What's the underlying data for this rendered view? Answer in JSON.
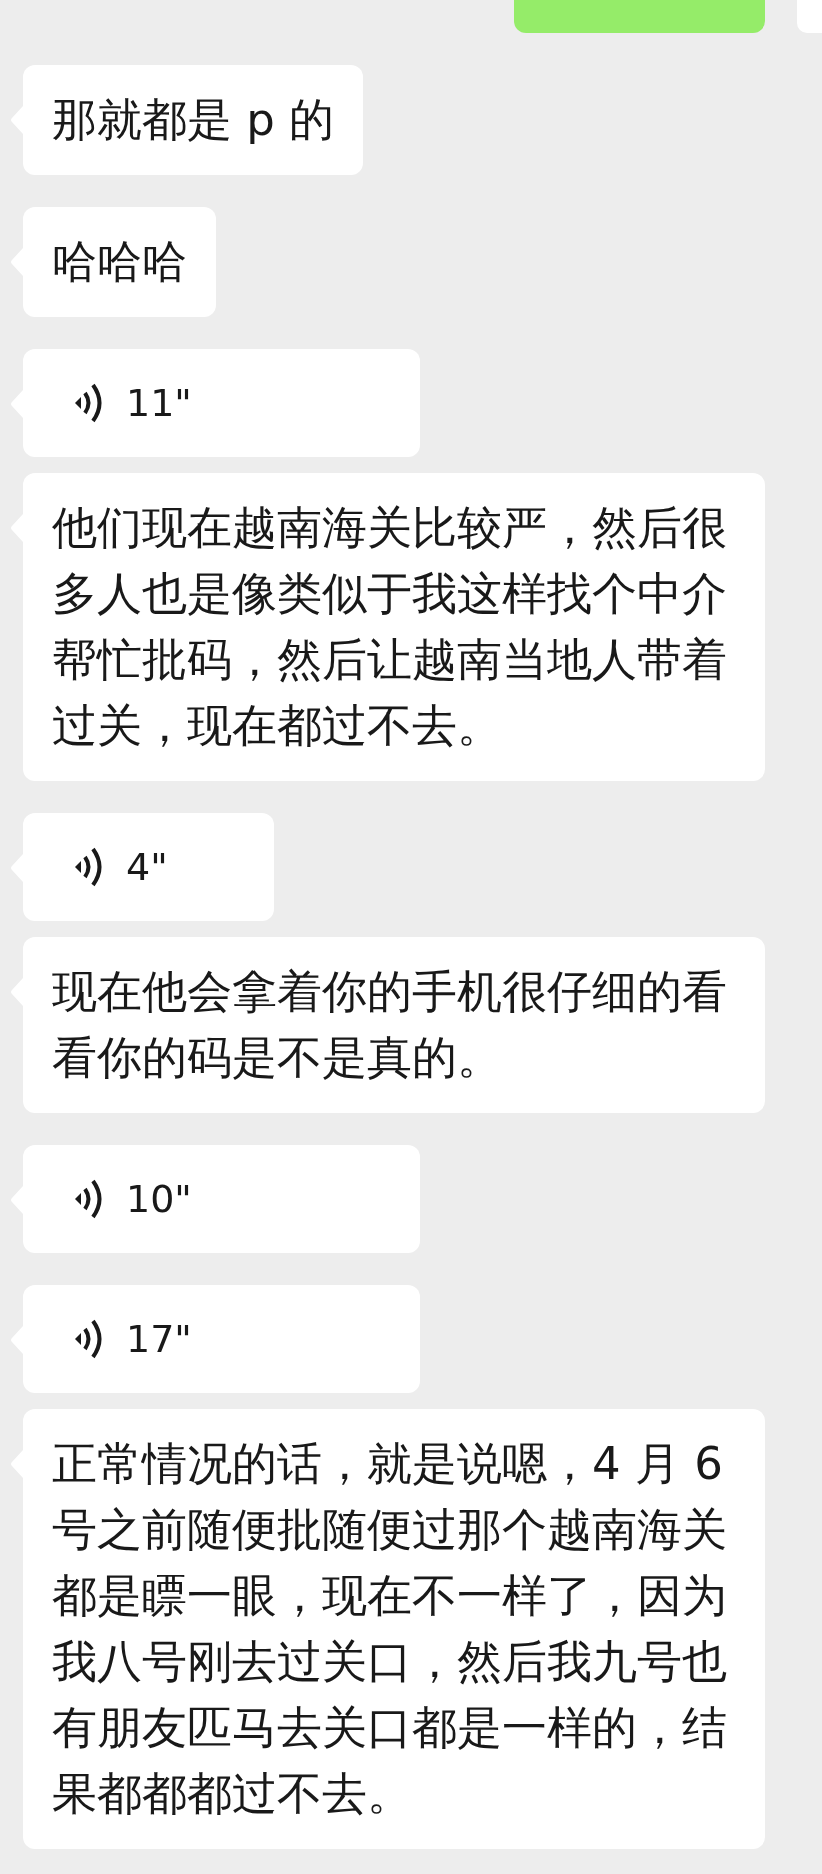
{
  "messages": [
    {
      "kind": "sent"
    },
    {
      "kind": "text",
      "text": "那就都是 p 的"
    },
    {
      "kind": "text",
      "text": "哈哈哈"
    },
    {
      "kind": "voice",
      "duration": "11\""
    },
    {
      "kind": "text",
      "text": "他们现在越南海关比较严，然后很多人也是像类似于我这样找个中介帮忙批码，然后让越南当地人带着过关，现在都过不去。"
    },
    {
      "kind": "voice",
      "duration": "4\""
    },
    {
      "kind": "text",
      "text": "现在他会拿着你的手机很仔细的看看你的码是不是真的。"
    },
    {
      "kind": "voice",
      "duration": "10\""
    },
    {
      "kind": "voice",
      "duration": "17\""
    },
    {
      "kind": "text",
      "text": "正常情况的话，就是说嗯，4 月 6 号之前随便批随便过那个越南海关都是瞟一眼，现在不一样了，因为我八号刚去过关口，然后我九号也有朋友匹马去关口都是一样的，结果都都都过不去。"
    }
  ]
}
